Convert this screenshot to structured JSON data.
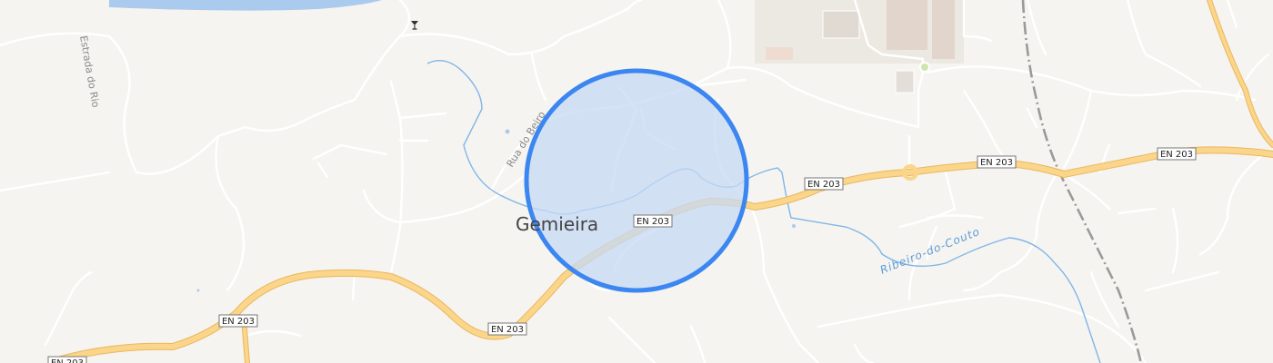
{
  "map": {
    "place_label": "Gemieira",
    "street_labels": {
      "estrada_do_rio": "Estrada do Rio",
      "rua_do_beiro": "Rua do Beiro"
    },
    "water_labels": {
      "ribeiro_do_couto": "Ribeiro-do-Couto"
    },
    "route_shields": [
      "EN 203",
      "EN 203",
      "EN 203",
      "EN 203",
      "EN 203",
      "EN 203"
    ],
    "colors": {
      "background": "#f6f4f0",
      "minor_road": "#ffffff",
      "major_road": "#fbd58a",
      "major_road_casing": "#e8b860",
      "water": "#7eb6e8",
      "railway": "#9a9a9a",
      "selection_fill": "#c6d9f5",
      "selection_stroke": "#3b86f0",
      "industrial": "#e4ded8"
    },
    "icons": [
      "cocktail-bar-icon"
    ]
  }
}
